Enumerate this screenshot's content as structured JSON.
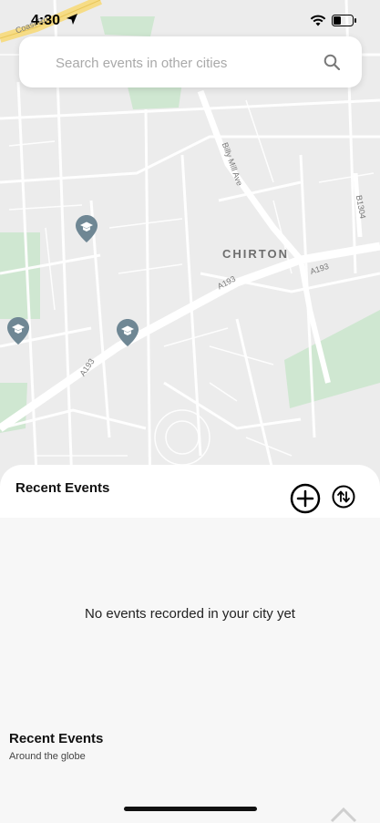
{
  "status_bar": {
    "time": "4:30"
  },
  "search": {
    "placeholder": "Search events in other cities"
  },
  "map": {
    "place_label": "CHIRTON",
    "road_labels": [
      "A193",
      "A193",
      "A193",
      "Billy Mill Ave",
      "B1304",
      "Coast Rd"
    ],
    "pins": [
      {
        "name": "school-pin"
      },
      {
        "name": "school-pin"
      },
      {
        "name": "school-pin"
      }
    ]
  },
  "panel": {
    "title": "Recent Events"
  },
  "empty_state": {
    "message": "No events recorded in your city yet"
  },
  "global": {
    "title": "Recent Events",
    "subtitle": "Around the globe"
  },
  "colors": {
    "map_bg": "#ececec",
    "park": "#cfe7d1",
    "road": "#ffffff",
    "pin": "#6f8794"
  }
}
